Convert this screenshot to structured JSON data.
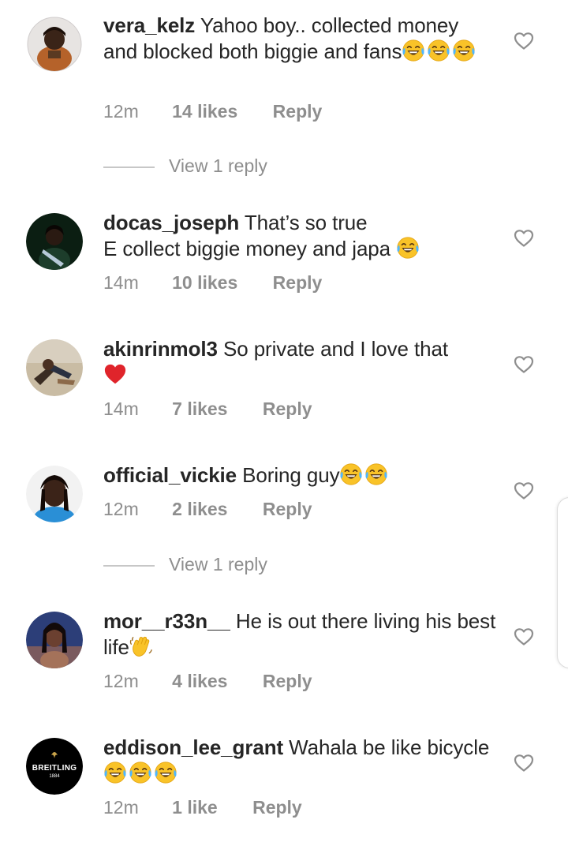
{
  "comments": [
    {
      "username": "vera_kelz",
      "text": "Yahoo boy.. collected money and blocked both biggie and fans",
      "time": "12m",
      "likes": "14 likes",
      "reply": "Reply",
      "view_replies": "View 1 reply"
    },
    {
      "username": "docas_joseph",
      "text_line1": "That’s so true",
      "text_line2": "E collect biggie money and japa",
      "time": "14m",
      "likes": "10 likes",
      "reply": "Reply"
    },
    {
      "username": "akinrinmol3",
      "text": "So private and I love that",
      "time": "14m",
      "likes": "7 likes",
      "reply": "Reply"
    },
    {
      "username": "official_vickie",
      "text": "Boring guy",
      "time": "12m",
      "likes": "2 likes",
      "reply": "Reply",
      "view_replies": "View 1 reply"
    },
    {
      "username": "mor__r33n__",
      "text": "He is out there living his best life",
      "time": "12m",
      "likes": "4 likes",
      "reply": "Reply"
    },
    {
      "username": "eddison_lee_grant",
      "text": "Wahala be like bicycle",
      "time": "12m",
      "likes": "1 like",
      "reply": "Reply"
    }
  ],
  "avatar_logo": {
    "brand": "BREITLING",
    "year": "1884"
  },
  "colors": {
    "primary_text": "#262626",
    "secondary_text": "#8e8e8e",
    "heart_red": "#e0242b",
    "emoji_yellow": "#f9c328",
    "divider": "#c7c7c7"
  },
  "icons": {
    "like": "heart-outline-icon",
    "laugh": "face-with-tears-of-joy-emoji",
    "love": "red-heart-emoji",
    "wave": "waving-hand-emoji"
  }
}
